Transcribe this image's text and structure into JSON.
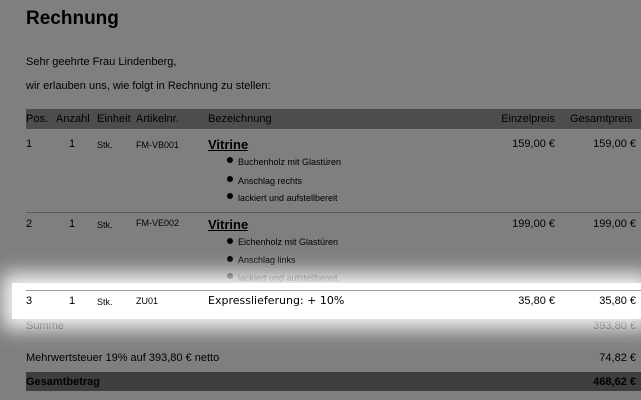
{
  "title": "Rechnung",
  "greeting": "Sehr geehrte Frau Lindenberg,",
  "intro": "wir erlauben uns, wie folgt in Rechnung zu stellen:",
  "headers": {
    "pos": "Pos.",
    "anzahl": "Anzahl",
    "einheit": "Einheit",
    "artikel": "Artikelnr.",
    "bezeichnung": "Bezeichnung",
    "einzelpreis": "Einzelpreis",
    "gesamtpreis": "Gesamtpreis"
  },
  "rows": [
    {
      "pos": "1",
      "anzahl": "1",
      "einheit": "Stk.",
      "artikel": "FM-VB001",
      "title": "Vitrine",
      "features": [
        "Buchenholz mit Glastüren",
        "Anschlag rechts",
        "lackiert und aufstellbereit"
      ],
      "einzelpreis": "159,00 €",
      "gesamtpreis": "159,00 €"
    },
    {
      "pos": "2",
      "anzahl": "1",
      "einheit": "Stk.",
      "artikel": "FM-VE002",
      "title": "Vitrine",
      "features": [
        "Eichenholz mit Glastüren",
        "Anschlag links",
        "lackiert und aufstellbereit"
      ],
      "einzelpreis": "199,00 €",
      "gesamtpreis": "199,00 €"
    },
    {
      "pos": "3",
      "anzahl": "1",
      "einheit": "Stk.",
      "artikel": "ZU01",
      "bezeichnung": "Expresslieferung: + 10%",
      "einzelpreis": "35,80 €",
      "gesamtpreis": "35,80 €"
    }
  ],
  "summe_label": "Summe",
  "summe_value": "393,80 €",
  "mwst_label": "Mehrwertsteuer 19% auf 393,80 € netto",
  "mwst_value": "74,82 €",
  "total_label": "Gesamtbetrag",
  "total_value": "468,62 €"
}
